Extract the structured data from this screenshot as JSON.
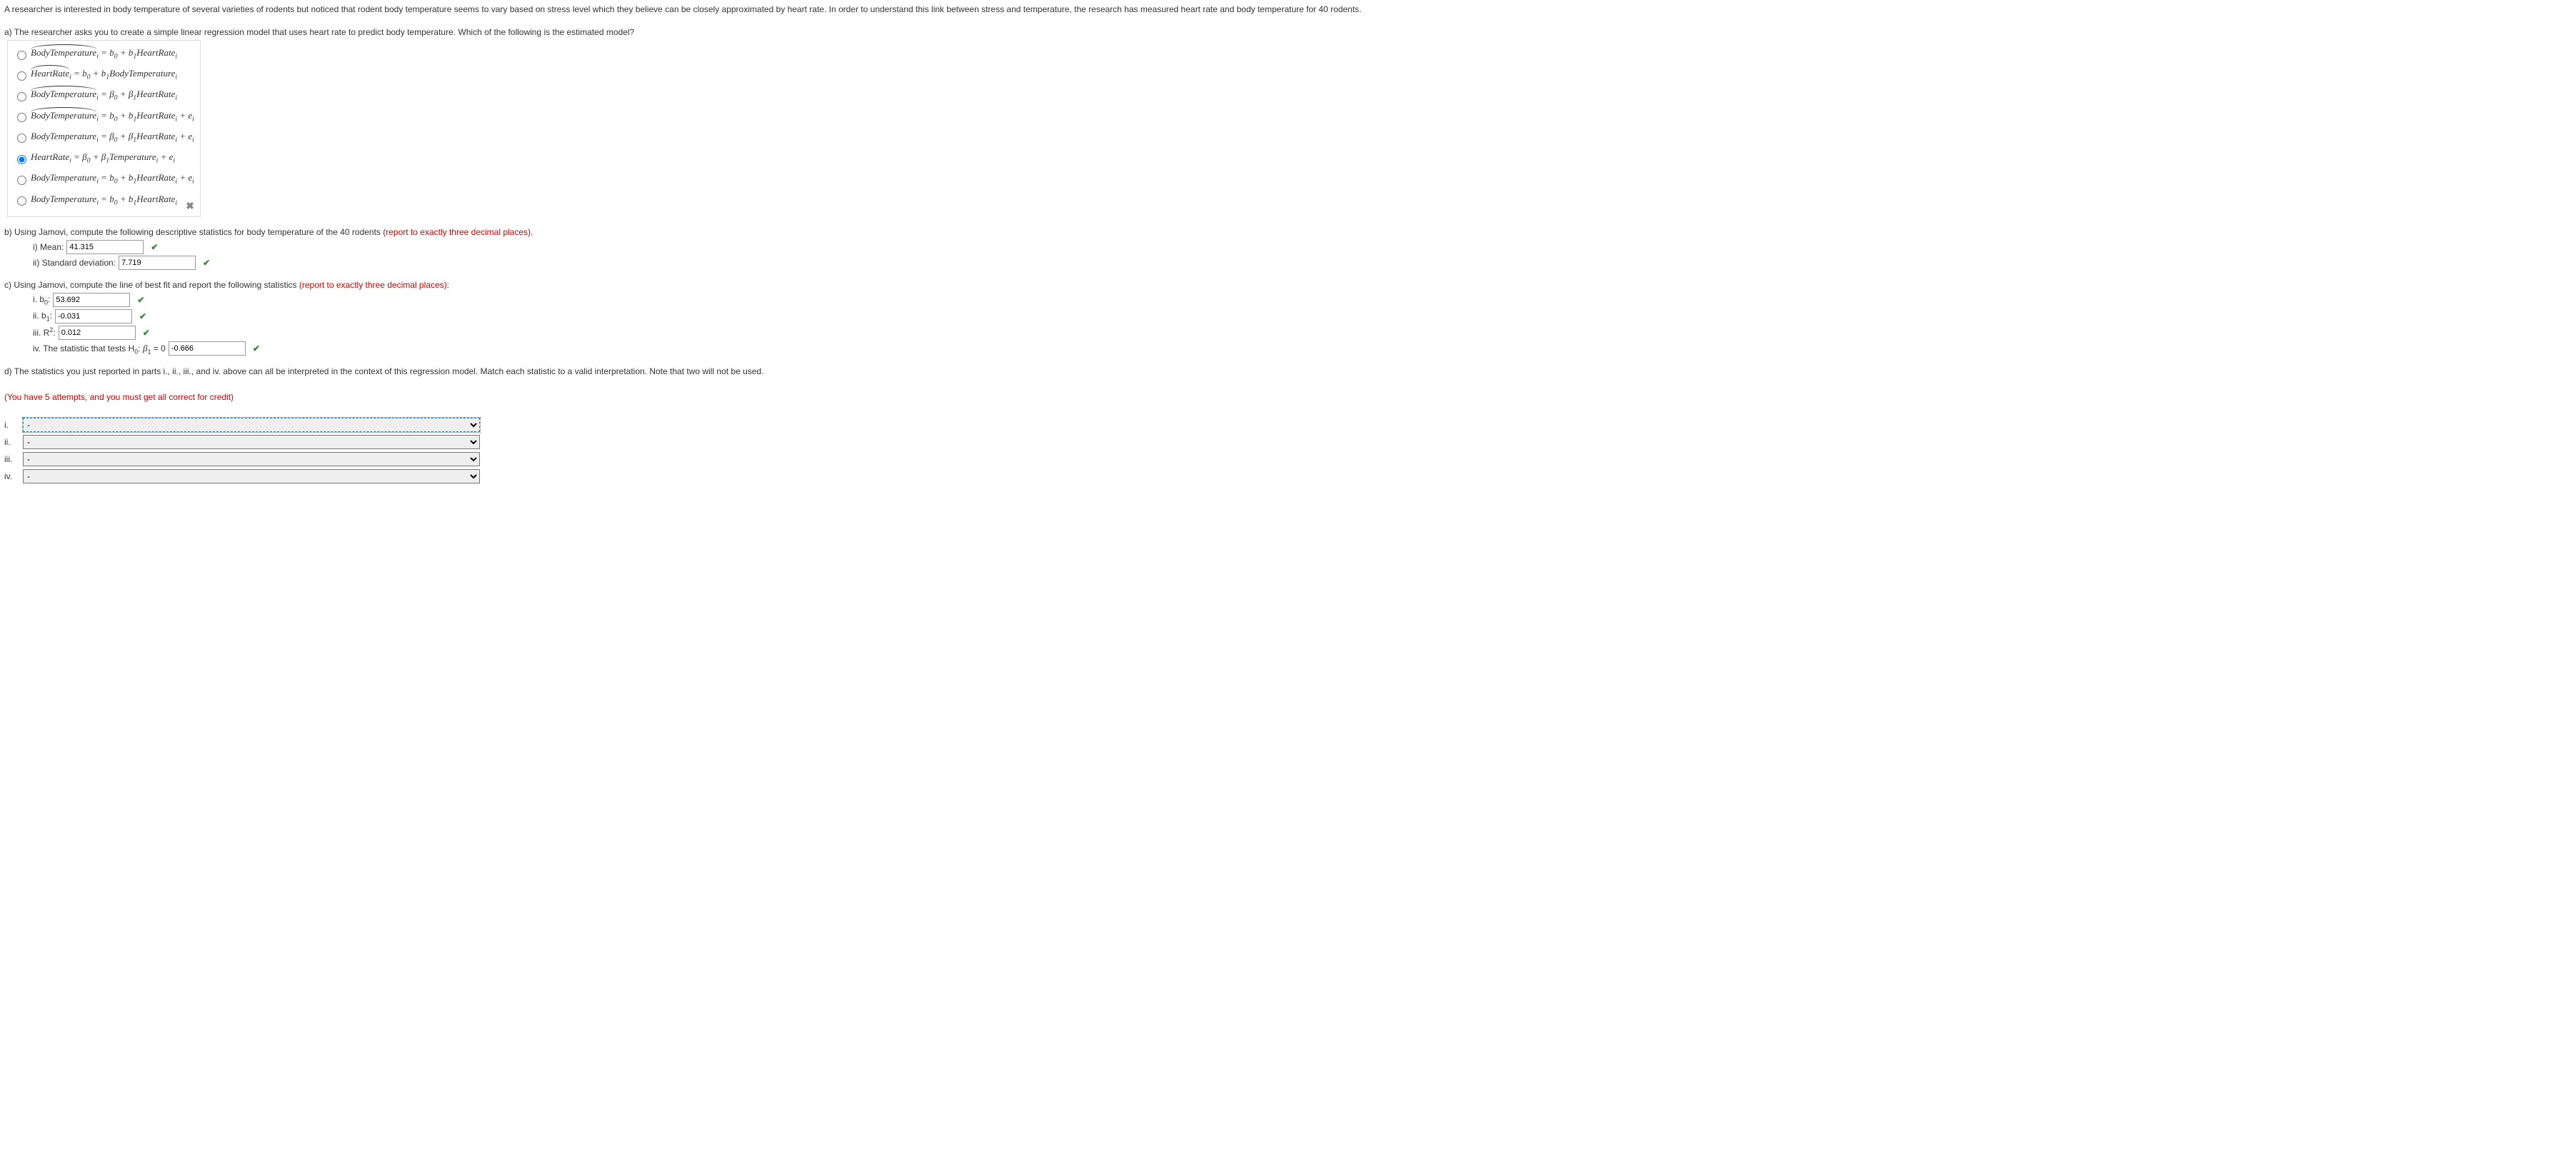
{
  "intro": "A researcher is interested in body temperature of several varieties of rodents but noticed that rodent body temperature seems to vary based on stress level which they believe can be closely approximated by heart rate. In order to understand this link between stress and temperature, the research has measured heart rate and body temperature for 40 rodents.",
  "partA": {
    "prompt": "a) The researcher asks you to create a simple linear regression model that uses heart rate to predict body temperature. Which of the following is the estimated model?",
    "options": [
      {
        "hat": true,
        "lhs": "BodyTemperature",
        "rhs": " = b₀ + b₁HeartRateᵢ"
      },
      {
        "hat": true,
        "lhs": "HeartRate",
        "rhs": " = b₀ + b₁BodyTemperatureᵢ"
      },
      {
        "hat": true,
        "lhs": "BodyTemperature",
        "rhs": " = β₀ + β₁HeartRateᵢ"
      },
      {
        "hat": true,
        "lhs": "BodyTemperature",
        "rhs": " = b₀ + b₁HeartRateᵢ + eᵢ"
      },
      {
        "hat": false,
        "lhs": "BodyTemperatureᵢ",
        "rhs": " = β₀ + β₁HeartRateᵢ + eᵢ"
      },
      {
        "hat": false,
        "lhs": "HeartRateᵢ",
        "rhs": " = β₀ + β₁Temperatureᵢ + eᵢ"
      },
      {
        "hat": false,
        "lhs": "BodyTemperatureᵢ",
        "rhs": " = b₀ + b₁HeartRateᵢ + eᵢ"
      },
      {
        "hat": false,
        "lhs": "BodyTemperatureᵢ",
        "rhs": " = b₀ + b₁HeartRateᵢ"
      }
    ],
    "selected_index": 5,
    "cross": "✖"
  },
  "partB": {
    "prompt_pre": "b) Using Jamovi, compute the following descriptive statistics for body temperature of the 40 rodents ",
    "prompt_red": "(report to exactly three decimal places).",
    "mean_label": "i) Mean:",
    "mean_value": "41.315",
    "sd_label": "ii) Standard deviation:",
    "sd_value": "7.719"
  },
  "partC": {
    "prompt_pre": "c) Using Jamovi, compute the line of best fit and report the following statistics ",
    "prompt_red": "(report to exactly three decimal places):",
    "b0_label": "i. b₀:",
    "b0_value": "53.692",
    "b1_label": "ii. b₁:",
    "b1_value": "-0.031",
    "r2_label_pre": "iii. R",
    "r2_label_post": ":",
    "r2_value": "0.012",
    "tstat_label": "iv. The statistic that tests H₀: β₁ = 0",
    "tstat_value": "-0.666"
  },
  "partD": {
    "prompt": "d) The statistics you just reported in parts i., ii., iii., and iv. above can all be interpreted in the context of this regression model. Match each statistic to a valid interpretation. Note that two will not be used.",
    "attempts_note": "(You have 5 attempts, and you must get all correct for credit)",
    "labels": [
      "i.",
      "ii.",
      "iii.",
      "iv."
    ],
    "placeholder": "-"
  },
  "check_mark": "✔"
}
